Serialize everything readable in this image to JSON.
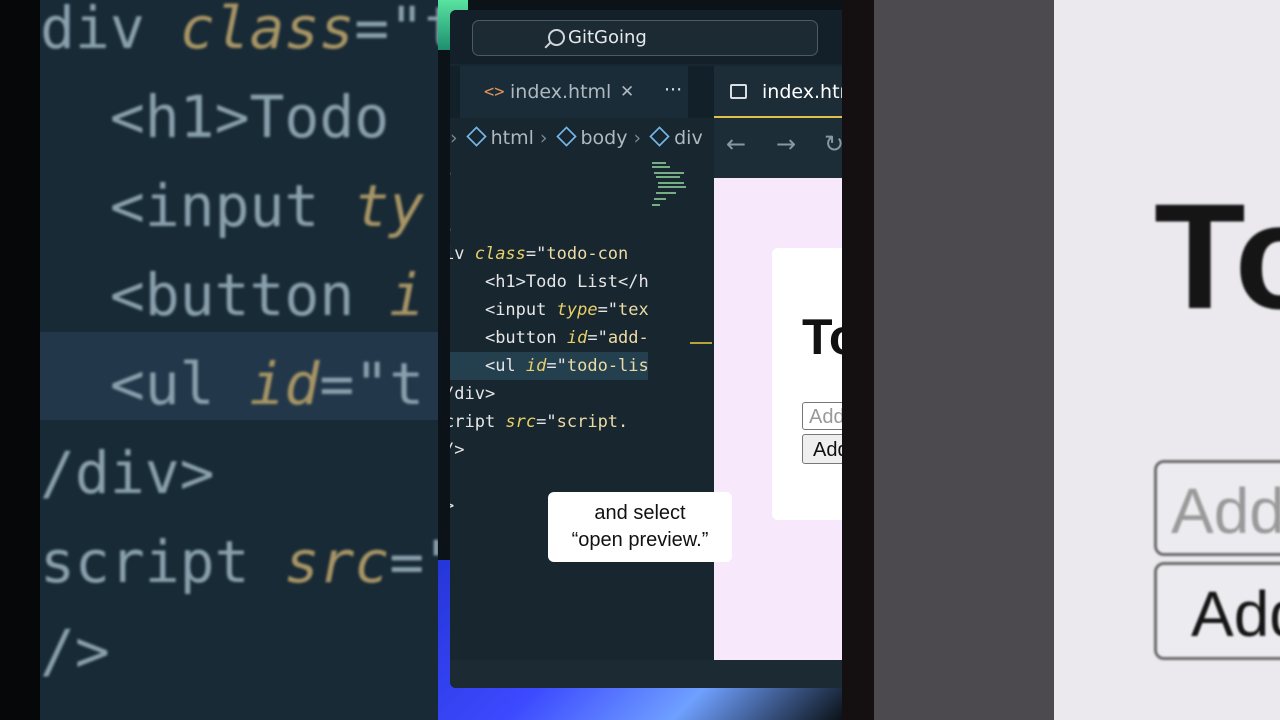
{
  "background_left": {
    "lines": [
      {
        "pre": "div ",
        "kw": "class",
        "post": "=\"to"
      },
      {
        "pre": "  <h1>Todo",
        "kw": "",
        "post": ""
      },
      {
        "pre": "  <input ",
        "kw": "ty",
        "post": ""
      },
      {
        "pre": "  <button ",
        "kw": "i",
        "post": ""
      },
      {
        "pre": "  <ul ",
        "kw": "id",
        "post": "=\"t"
      },
      {
        "pre": "/div>",
        "kw": "",
        "post": ""
      },
      {
        "pre": "script ",
        "kw": "src",
        "post": "=\""
      },
      {
        "pre": "/>",
        "kw": "",
        "post": ""
      }
    ]
  },
  "background_right": {
    "title": "To",
    "input_text": "Add",
    "button_text": "Add"
  },
  "window": {
    "search_label": "GitGoing"
  },
  "tabs": {
    "editor_tab": {
      "icon": "<>",
      "label": "index.html",
      "close": "✕"
    },
    "more": "···",
    "preview_tab": {
      "label": "index.htm"
    }
  },
  "breadcrumb": {
    "items": [
      "html",
      "body",
      "div"
    ]
  },
  "code_lines": [
    {
      "indent": "",
      "parts": [
        {
          "t": "."
        }
      ]
    },
    {
      "indent": "",
      "parts": [
        {
          "t": ""
        }
      ]
    },
    {
      "indent": "",
      "parts": [
        {
          "t": "."
        }
      ]
    },
    {
      "indent": "",
      "parts": [
        {
          "t": "iv "
        },
        {
          "t": "class",
          "c": "attr"
        },
        {
          "t": "=\""
        },
        {
          "t": "todo-con",
          "c": "str"
        }
      ]
    },
    {
      "indent": "    ",
      "parts": [
        {
          "t": "<h1>Todo List</h"
        }
      ]
    },
    {
      "indent": "    ",
      "parts": [
        {
          "t": "<input "
        },
        {
          "t": "type",
          "c": "attr"
        },
        {
          "t": "=\""
        },
        {
          "t": "tex",
          "c": "str"
        }
      ]
    },
    {
      "indent": "    ",
      "parts": [
        {
          "t": "<button "
        },
        {
          "t": "id",
          "c": "attr"
        },
        {
          "t": "=\""
        },
        {
          "t": "add-",
          "c": "str"
        }
      ]
    },
    {
      "indent": "    ",
      "parts": [
        {
          "t": "<ul "
        },
        {
          "t": "id",
          "c": "attr"
        },
        {
          "t": "=\""
        },
        {
          "t": "todo-lis",
          "c": "str"
        }
      ],
      "selected": true
    },
    {
      "indent": "",
      "parts": [
        {
          "t": "/div>"
        }
      ]
    },
    {
      "indent": "",
      "parts": [
        {
          "t": "cript "
        },
        {
          "t": "src",
          "c": "attr"
        },
        {
          "t": "=\""
        },
        {
          "t": "script.",
          "c": "str"
        }
      ]
    },
    {
      "indent": "",
      "parts": [
        {
          "t": "/>"
        }
      ]
    },
    {
      "indent": "",
      "parts": [
        {
          "t": ""
        }
      ]
    },
    {
      "indent": "",
      "parts": [
        {
          "t": ">"
        }
      ]
    }
  ],
  "preview": {
    "nav": {
      "back": "←",
      "forward": "→",
      "reload": "↻"
    },
    "title": "To",
    "input_placeholder": "Add",
    "button_label": "Add"
  },
  "caption": {
    "line1": "and select",
    "line2": "“open preview.”"
  },
  "colors": {
    "accent_tab": "#e1c14b",
    "preview_bg": "#f7e9fb",
    "editor_bg": "#17262f"
  }
}
